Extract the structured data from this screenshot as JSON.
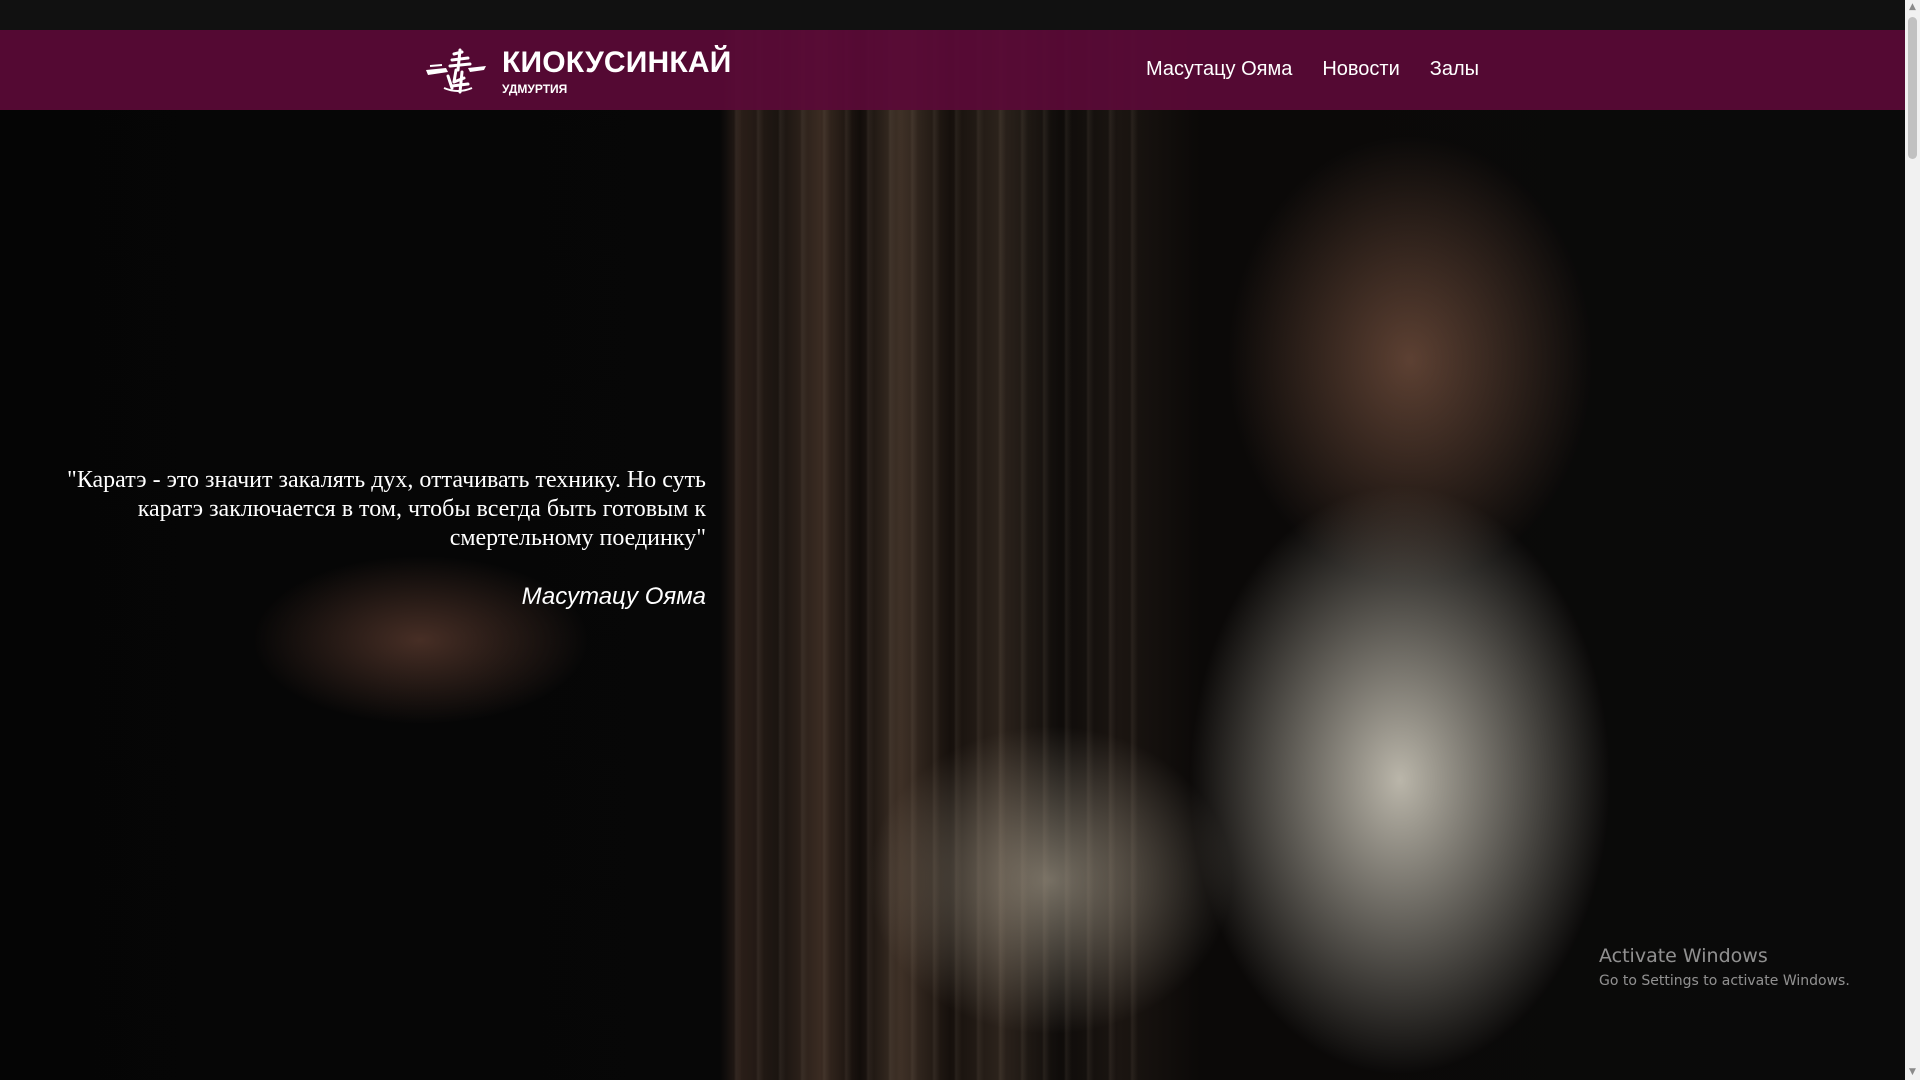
{
  "header": {
    "logo": {
      "title": "КИОКУСИНКАЙ",
      "subtitle": "УДМУРТИЯ",
      "icon": "kanji-fighter-logo"
    },
    "nav": [
      {
        "label": "Масутацу Ояма"
      },
      {
        "label": "Новости"
      },
      {
        "label": "Залы"
      }
    ],
    "background_color": "#5a0a37"
  },
  "hero": {
    "quote": "\"Каратэ - это значит закалять дух, оттачивать технику. Но суть каратэ заключается в том, чтобы всегда быть готовым к смертельному поединку\"",
    "author": "Масутацу Ояма",
    "image": "photo-of-masutatsu-oyama-in-karate-gi"
  },
  "watermark": {
    "title": "Activate Windows",
    "subtitle": "Go to Settings to activate Windows."
  }
}
